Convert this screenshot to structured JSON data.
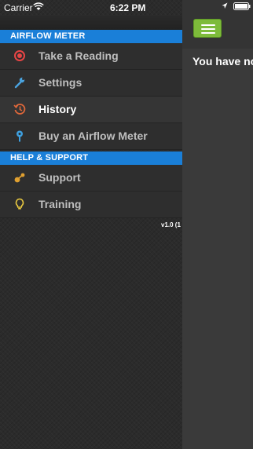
{
  "status_bar": {
    "carrier": "Carrier",
    "time": "6:22 PM",
    "battery_icon": "battery-icon",
    "location_icon": "location-arrow-icon"
  },
  "menu": {
    "section1": "AIRFLOW METER",
    "items1": [
      {
        "label": "Take a Reading",
        "icon": "record-icon",
        "color": "#e84545"
      },
      {
        "label": "Settings",
        "icon": "wrench-icon",
        "color": "#4aa3df"
      },
      {
        "label": "History",
        "icon": "history-icon",
        "color": "#e0683a",
        "active": true
      },
      {
        "label": "Buy an Airflow Meter",
        "icon": "map-pin-icon",
        "color": "#3ea0e0"
      }
    ],
    "section2": "HELP & SUPPORT",
    "items2": [
      {
        "label": "Support",
        "icon": "support-icon",
        "color": "#e0a030"
      },
      {
        "label": "Training",
        "icon": "lightbulb-icon",
        "color": "#e8c840"
      }
    ],
    "version": "v1.0 (1"
  },
  "content": {
    "message": "You have no",
    "menu_button_icon": "hamburger-menu-icon",
    "accent": "#7dbb3a"
  },
  "colors": {
    "section_bg": "#1a7fd8",
    "menu_bg": "#2e2e2e"
  }
}
